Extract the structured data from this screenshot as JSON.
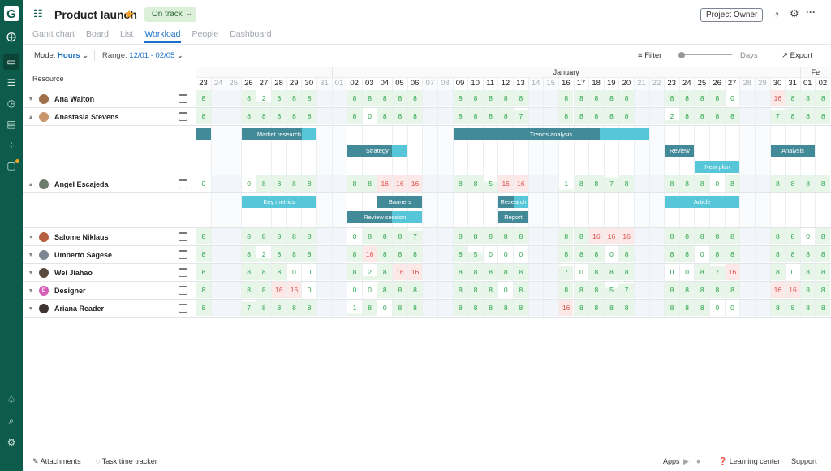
{
  "app": {
    "logo": "G",
    "title": "Product launch",
    "status": "On track",
    "role": "Project Owner"
  },
  "icons": {
    "star": "star-icon",
    "history": "history-icon",
    "settings": "gear-icon",
    "more": "more-icon"
  },
  "tabs": [
    "Gantt chart",
    "Board",
    "List",
    "Workload",
    "People",
    "Dashboard"
  ],
  "active_tab": "Workload",
  "toolbar": {
    "mode_label": "Mode:",
    "mode_value": "Hours",
    "range_label": "Range:",
    "range_value": "12/01 - 02/05",
    "filter": "Filter",
    "zoom_label": "Days",
    "export": "Export"
  },
  "grid": {
    "resource_header": "Resource",
    "months": [
      {
        "label": "",
        "span": 9
      },
      {
        "label": "January",
        "span": 31
      },
      {
        "label": "Fe",
        "span": 2
      }
    ],
    "dates": [
      "23",
      "24",
      "25",
      "26",
      "27",
      "28",
      "29",
      "30",
      "31",
      "01",
      "02",
      "03",
      "04",
      "05",
      "06",
      "07",
      "08",
      "09",
      "10",
      "11",
      "12",
      "13",
      "14",
      "15",
      "16",
      "17",
      "18",
      "19",
      "20",
      "21",
      "22",
      "23",
      "24",
      "25",
      "26",
      "27",
      "28",
      "29",
      "30",
      "31",
      "01",
      "02"
    ],
    "weekend": [
      1,
      2,
      8,
      9,
      15,
      16,
      22,
      23,
      29,
      30,
      36,
      37
    ]
  },
  "colors": {
    "sidebar": "#0d5c4b",
    "accent": "#1b6fc4",
    "ok": "#2ea44f",
    "over": "#d9534f",
    "task_progress": "#438a99",
    "task": "#56c6d8"
  },
  "resources": [
    {
      "name": "Ana Walton",
      "expanded": false,
      "avatar": "#a0704a",
      "hours": [
        8,
        null,
        null,
        8,
        2,
        8,
        8,
        8,
        null,
        null,
        8,
        8,
        8,
        8,
        8,
        null,
        null,
        8,
        8,
        8,
        8,
        8,
        null,
        null,
        8,
        8,
        8,
        8,
        8,
        null,
        null,
        8,
        8,
        8,
        8,
        0,
        null,
        null,
        16,
        8,
        8,
        8
      ],
      "tasks": []
    },
    {
      "name": "Anastasia Stevens",
      "expanded": true,
      "avatar": "#c9956a",
      "hours": [
        8,
        null,
        null,
        8,
        8,
        8,
        8,
        8,
        null,
        null,
        8,
        0,
        8,
        8,
        8,
        null,
        null,
        8,
        8,
        8,
        8,
        7,
        null,
        null,
        8,
        8,
        8,
        8,
        8,
        null,
        null,
        2,
        8,
        8,
        8,
        8,
        null,
        null,
        7,
        8,
        8,
        8
      ],
      "lanes": 3,
      "tasks": [
        {
          "name": "",
          "start": 0,
          "end": 0,
          "progress": 1,
          "lane": 0
        },
        {
          "name": "Market research",
          "start": 3,
          "end": 7,
          "progress": 0.8,
          "lane": 0
        },
        {
          "name": "Trends analysis",
          "start": 17,
          "end": 29,
          "progress": 0.75,
          "lane": 0
        },
        {
          "name": "Strategy",
          "start": 10,
          "end": 13,
          "progress": 0.75,
          "lane": 1
        },
        {
          "name": "Review",
          "start": 31,
          "end": 32,
          "progress": 1,
          "lane": 1
        },
        {
          "name": "Analysis",
          "start": 38,
          "end": 40,
          "progress": 1,
          "lane": 1
        },
        {
          "name": "New plan",
          "start": 33,
          "end": 35,
          "progress": 0,
          "lane": 2
        }
      ]
    },
    {
      "name": "Angel Escajeda",
      "expanded": true,
      "avatar": "#6b7d6a",
      "hours": [
        0,
        null,
        null,
        0,
        8,
        8,
        8,
        8,
        null,
        null,
        8,
        8,
        16,
        16,
        16,
        null,
        null,
        8,
        8,
        5,
        16,
        16,
        null,
        null,
        1,
        8,
        8,
        7,
        8,
        null,
        null,
        8,
        8,
        8,
        0,
        8,
        null,
        null,
        8,
        8,
        8,
        8
      ],
      "lanes": 2,
      "tasks": [
        {
          "name": "Key metrics",
          "start": 3,
          "end": 7,
          "progress": 0,
          "lane": 0
        },
        {
          "name": "Banners",
          "start": 12,
          "end": 14,
          "progress": 1,
          "lane": 0
        },
        {
          "name": "Research",
          "start": 20,
          "end": 21,
          "progress": 0.5,
          "lane": 0
        },
        {
          "name": "Article",
          "start": 31,
          "end": 35,
          "progress": 0,
          "lane": 0
        },
        {
          "name": "Review session",
          "start": 10,
          "end": 14,
          "progress": 0.6,
          "lane": 1
        },
        {
          "name": "Report",
          "start": 20,
          "end": 21,
          "progress": 1,
          "lane": 1
        }
      ]
    },
    {
      "name": "Salome Niklaus",
      "expanded": false,
      "avatar": "#b5603e",
      "hours": [
        8,
        null,
        null,
        8,
        8,
        8,
        8,
        8,
        null,
        null,
        0,
        8,
        8,
        8,
        7,
        null,
        null,
        8,
        8,
        8,
        8,
        8,
        null,
        null,
        8,
        8,
        16,
        16,
        16,
        null,
        null,
        8,
        8,
        8,
        8,
        8,
        null,
        null,
        8,
        8,
        0,
        8
      ],
      "tasks": []
    },
    {
      "name": "Umberto Sagese",
      "expanded": false,
      "avatar": "#7c8690",
      "hours": [
        8,
        null,
        null,
        8,
        2,
        8,
        8,
        8,
        null,
        null,
        8,
        16,
        8,
        8,
        8,
        null,
        null,
        8,
        5,
        0,
        0,
        0,
        null,
        null,
        8,
        8,
        8,
        0,
        8,
        null,
        null,
        8,
        8,
        0,
        8,
        8,
        null,
        null,
        8,
        8,
        8,
        8
      ],
      "tasks": []
    },
    {
      "name": "Wei Jiahao",
      "expanded": false,
      "avatar": "#5a4a3e",
      "hours": [
        8,
        null,
        null,
        8,
        8,
        8,
        0,
        0,
        null,
        null,
        8,
        2,
        8,
        16,
        16,
        null,
        null,
        8,
        8,
        8,
        8,
        8,
        null,
        null,
        7,
        0,
        8,
        8,
        8,
        null,
        null,
        0,
        0,
        8,
        7,
        16,
        null,
        null,
        8,
        0,
        8,
        8
      ],
      "tasks": []
    },
    {
      "name": "Designer",
      "expanded": false,
      "avatar": "#d45db5",
      "initial": "D",
      "hours": [
        8,
        null,
        null,
        8,
        8,
        16,
        16,
        0,
        null,
        null,
        0,
        0,
        8,
        8,
        8,
        null,
        null,
        8,
        8,
        8,
        0,
        8,
        null,
        null,
        8,
        8,
        8,
        5,
        7,
        null,
        null,
        8,
        8,
        8,
        8,
        8,
        null,
        null,
        16,
        16,
        8,
        8
      ],
      "tasks": []
    },
    {
      "name": "Ariana Reader",
      "expanded": false,
      "avatar": "#3e3530",
      "hours": [
        8,
        null,
        null,
        7,
        8,
        8,
        8,
        8,
        null,
        null,
        1,
        8,
        0,
        8,
        8,
        null,
        null,
        8,
        8,
        8,
        8,
        8,
        null,
        null,
        16,
        8,
        8,
        8,
        8,
        null,
        null,
        8,
        8,
        8,
        0,
        0,
        null,
        null,
        8,
        8,
        8,
        8
      ],
      "tasks": []
    }
  ],
  "footer": {
    "attachments": "Attachments",
    "tracker": "Task time tracker",
    "apps": "Apps",
    "learning": "Learning center",
    "support": "Support"
  }
}
